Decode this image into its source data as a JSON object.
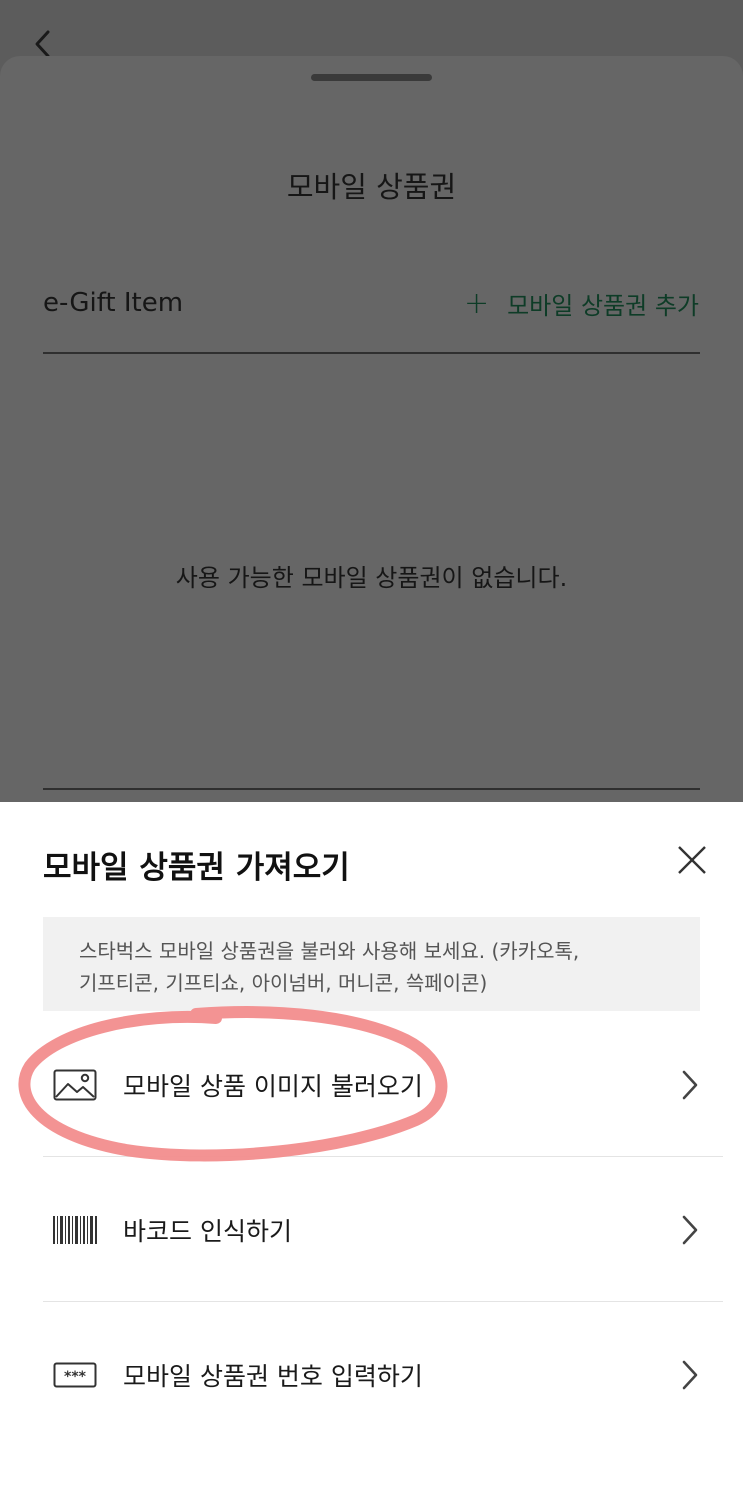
{
  "background_screen": {
    "title": "모바일 상품권",
    "section_label": "e-Gift Item",
    "add_button_label": "모바일 상품권 추가",
    "empty_message": "사용 가능한 모바일 상품권이 없습니다."
  },
  "bottom_sheet": {
    "title": "모바일 상품권 가져오기",
    "info_line_1": "스타벅스 모바일 상품권을 불러와 사용해 보세요. (카카오톡,",
    "info_line_2": "기프티콘, 기프티쇼, 아이넘버, 머니콘, 쓱페이콘)",
    "items": [
      {
        "label": "모바일 상품 이미지 불러오기",
        "icon": "image-icon"
      },
      {
        "label": "바코드 인식하기",
        "icon": "barcode-icon"
      },
      {
        "label": "모바일 상품권 번호 입력하기",
        "icon": "password-code-icon"
      }
    ]
  },
  "colors": {
    "accent_green": "#0e3c27",
    "highlight_annotation": "#f08a8a",
    "dim_overlay": "#5c5c5c"
  }
}
